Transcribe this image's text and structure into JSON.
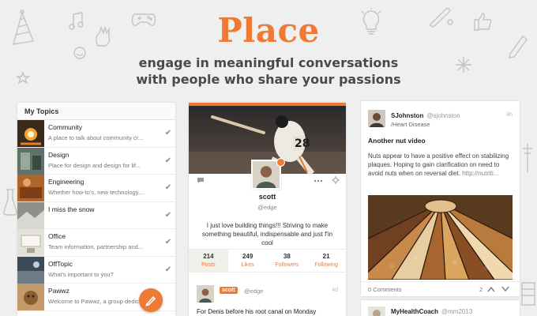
{
  "hero": {
    "title": "Place",
    "subtitle_line1": "engage in meaningful conversations",
    "subtitle_line2": "with people who share your passions"
  },
  "topics": {
    "header": "My Topics",
    "items": [
      {
        "name": "Community",
        "desc": "A place to talk about community cr...",
        "checked": true
      },
      {
        "name": "Design",
        "desc": "Place for design and design for lif...",
        "checked": true
      },
      {
        "name": "Engineering",
        "desc": "Whether how-to's, new technology,...",
        "checked": true
      },
      {
        "name": "I miss the snow",
        "desc": "",
        "checked": true
      },
      {
        "name": "Office",
        "desc": "Team information, partnership and...",
        "checked": true
      },
      {
        "name": "OffTopic",
        "desc": "What's important to you?",
        "checked": true
      },
      {
        "name": "Pawwz",
        "desc": "Welcome to Pawwz, a group dedic...",
        "checked": false
      }
    ]
  },
  "profile": {
    "name": "scott",
    "handle": "@edge",
    "bio": "I just love building things!!! Striving to make something beautiful, indispensable and just f'in cool",
    "stats": [
      {
        "num": "214",
        "label": "Posts",
        "active": true
      },
      {
        "num": "249",
        "label": "Likes",
        "active": false
      },
      {
        "num": "38",
        "label": "Followers",
        "active": false
      },
      {
        "num": "21",
        "label": "Following",
        "active": false
      }
    ],
    "post": {
      "badge": "scott",
      "handle": "@edge",
      "time": "4d",
      "text": "For Denis before his root canal on Monday"
    }
  },
  "feed": {
    "user": "SJohnston",
    "handle": "@sjohnston",
    "topic": "/Heart Disease",
    "time": "8h",
    "title": "Another nut video",
    "body": "Nuts appear to have a positive effect on stabilizing plaques. Hoping to gain clarification on need to avoid nuts when on reversal diet.",
    "link": "http://nutriti...",
    "comments": "0 Comments",
    "votes": "2",
    "next_user": "MyHealthCoach",
    "next_handle": "@mm2013"
  },
  "colors": {
    "accent": "#ee7a35",
    "background": "#efefef"
  }
}
